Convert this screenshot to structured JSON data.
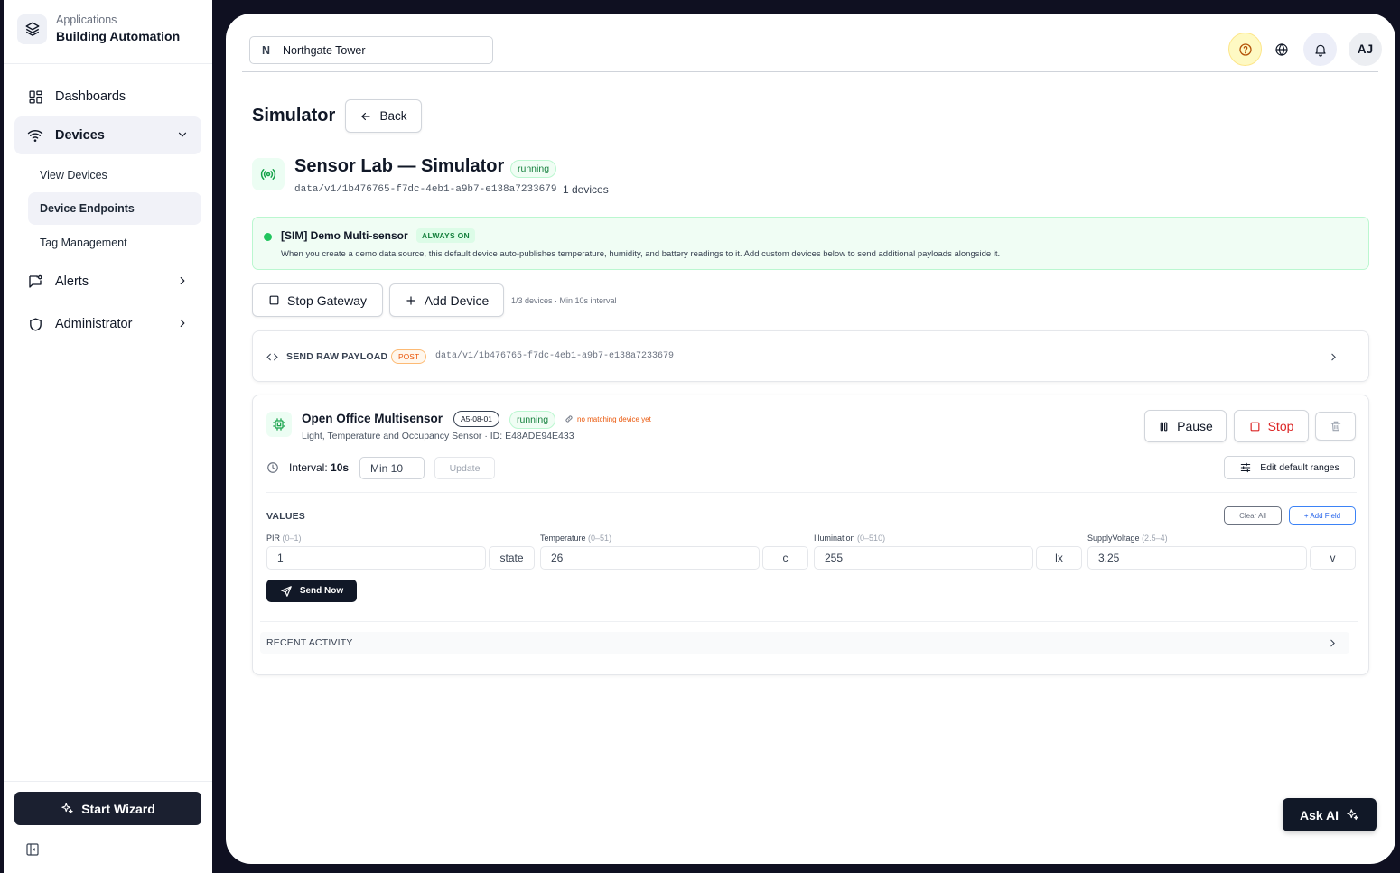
{
  "sidebar": {
    "brand": {
      "small": "Applications",
      "big": "Building Automation"
    },
    "nav": {
      "dashboards": "Dashboards",
      "devices": "Devices",
      "alerts": "Alerts",
      "administrator": "Administrator"
    },
    "sub": {
      "view_devices": "View Devices",
      "device_endpoints": "Device Endpoints",
      "tag_management": "Tag Management"
    },
    "wizard": "Start Wizard"
  },
  "header": {
    "site_initial": "N",
    "site_name": "Northgate Tower",
    "avatar": "AJ"
  },
  "page": {
    "title": "Simulator",
    "back": "Back"
  },
  "source": {
    "title": "Sensor Lab — Simulator",
    "status": "running",
    "path": "data/v1/1b476765-f7dc-4eb1-a9b7-e138a7233679",
    "count": "1 devices"
  },
  "sim": {
    "name": "[SIM] Demo Multi-sensor",
    "badge": "ALWAYS ON",
    "desc": "When you create a demo data source, this default device auto-publishes temperature, humidity, and battery readings to it. Add custom devices below to send additional payloads alongside it."
  },
  "gateway": {
    "stop": "Stop Gateway",
    "add": "Add Device",
    "hint": "1/3 devices · Min 10s interval"
  },
  "raw": {
    "label": "SEND RAW PAYLOAD",
    "method": "POST",
    "path": "data/v1/1b476765-f7dc-4eb1-a9b7-e138a7233679"
  },
  "device": {
    "name": "Open Office Multisensor",
    "eep": "A5-08-01",
    "status": "running",
    "nomatch": "no matching device yet",
    "sub": "Light, Temperature and Occupancy Sensor · ID: E48ADE94E433",
    "pause": "Pause",
    "stop": "Stop",
    "interval_label": "Interval: ",
    "interval_value": "10s",
    "interval_input": "Min 10",
    "update": "Update",
    "edit_ranges": "Edit default ranges",
    "values_label": "VALUES",
    "clear_all": "Clear All",
    "add_field": "+ Add Field",
    "fields": [
      {
        "name": "PIR",
        "range": "(0–1)",
        "value": "1",
        "unit": "state"
      },
      {
        "name": "Temperature",
        "range": "(0–51)",
        "value": "26",
        "unit": "c"
      },
      {
        "name": "Illumination",
        "range": "(0–510)",
        "value": "255",
        "unit": "lx"
      },
      {
        "name": "SupplyVoltage",
        "range": "(2.5–4)",
        "value": "3.25",
        "unit": "v"
      }
    ],
    "send_now": "Send Now",
    "recent": "RECENT ACTIVITY"
  },
  "askai": "Ask AI",
  "colors": {
    "accent_dark": "#111827",
    "running_green": "#15803d",
    "stop_red": "#dc2626",
    "warn_orange": "#ea580c",
    "help_yellow": "#fef9c3"
  }
}
